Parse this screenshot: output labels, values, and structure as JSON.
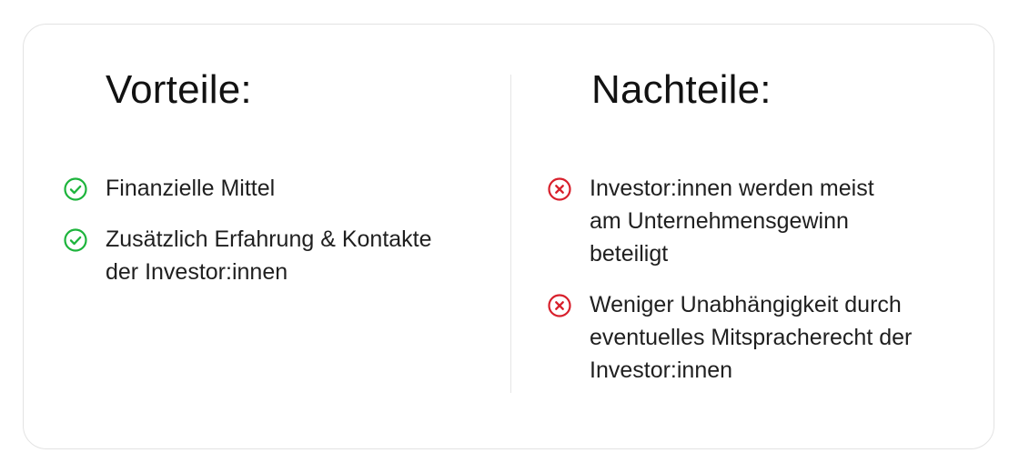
{
  "colors": {
    "positive": "#1db43c",
    "negative": "#d8202c",
    "border": "#e3e3e3",
    "divider": "#e6e6e6"
  },
  "advantages": {
    "title": "Vorteile:",
    "icon": "check-circle-icon",
    "items": [
      {
        "lines": [
          "Finanzielle Mittel"
        ]
      },
      {
        "lines": [
          "Zusätzlich Erfahrung & Kontakte",
          "der Investor:innen"
        ]
      }
    ]
  },
  "disadvantages": {
    "title": "Nachteile:",
    "icon": "x-circle-icon",
    "items": [
      {
        "lines": [
          "Investor:innen werden meist",
          "am Unternehmensgewinn",
          "beteiligt"
        ]
      },
      {
        "lines": [
          "Weniger Unabhängigkeit durch",
          "eventuelles Mitspracherecht der",
          "Investor:innen"
        ]
      }
    ]
  }
}
